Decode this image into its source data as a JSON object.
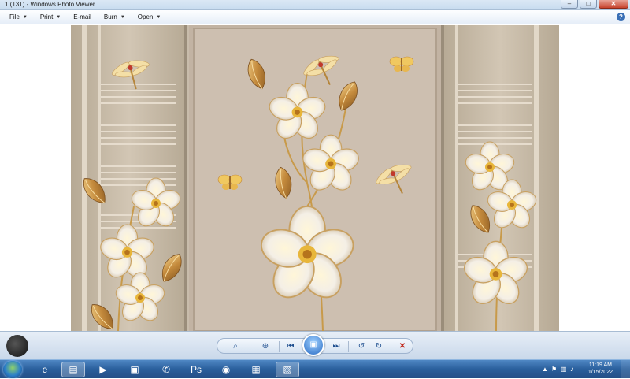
{
  "window": {
    "title": "1 (131) - Windows Photo Viewer",
    "minimize_glyph": "–",
    "maximize_glyph": "□",
    "close_glyph": "✕"
  },
  "menubar": {
    "items": [
      {
        "label": "File",
        "has_arrow": true
      },
      {
        "label": "Print",
        "has_arrow": true
      },
      {
        "label": "E-mail",
        "has_arrow": false
      },
      {
        "label": "Burn",
        "has_arrow": true
      },
      {
        "label": "Open",
        "has_arrow": true
      }
    ],
    "help_glyph": "?"
  },
  "controls": {
    "zoom_icon": "zoom-icon",
    "fit_icon": "actual-size-icon",
    "prev_icon": "previous-icon",
    "slideshow_icon": "slideshow-icon",
    "next_icon": "next-icon",
    "rotate_ccw_icon": "rotate-counterclockwise-icon",
    "rotate_cw_icon": "rotate-clockwise-icon",
    "delete_icon": "delete-icon",
    "delete_color": "#c0291b"
  },
  "taskbar": {
    "apps": [
      {
        "name": "internet-explorer-icon",
        "glyph": "e"
      },
      {
        "name": "file-explorer-icon",
        "glyph": "▤"
      },
      {
        "name": "media-player-icon",
        "glyph": "▶"
      },
      {
        "name": "app-icon",
        "glyph": "▣"
      },
      {
        "name": "phone-icon",
        "glyph": "✆"
      },
      {
        "name": "photoshop-icon",
        "glyph": "Ps"
      },
      {
        "name": "chrome-icon",
        "glyph": "◉"
      },
      {
        "name": "calculator-icon",
        "glyph": "▦"
      },
      {
        "name": "photo-viewer-icon",
        "glyph": "▧"
      }
    ],
    "clock_time": "11:19 AM",
    "clock_date": "1/15/2022"
  },
  "colors": {
    "taskbar": "#2a5f9c",
    "photo_background": "#c7bba9",
    "gold": "#c89a4a",
    "petal": "#f6f1e7"
  }
}
